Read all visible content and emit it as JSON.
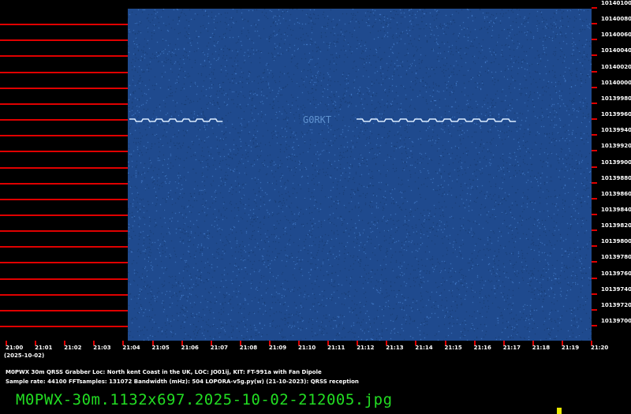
{
  "waterfall": {
    "background_color": "#1f4a8e",
    "noise_color": "#4a86d8",
    "signal_color": "#dcecff",
    "ident_text": "G0RKT",
    "ident_color": "#6fa4e0"
  },
  "reference_line_color": "#e00000",
  "frequency_axis": {
    "labels": [
      "10140100",
      "10140080",
      "10140060",
      "10140040",
      "10140020",
      "10140000",
      "10139980",
      "10139960",
      "10139940",
      "10139920",
      "10139900",
      "10139880",
      "10139860",
      "10139840",
      "10139820",
      "10139800",
      "10139780",
      "10139760",
      "10139740",
      "10139720",
      "10139700"
    ]
  },
  "time_axis": {
    "labels": [
      "21:00",
      "21:01",
      "21:02",
      "21:03",
      "21:04",
      "21:05",
      "21:06",
      "21:07",
      "21:08",
      "21:09",
      "21:10",
      "21:11",
      "21:12",
      "21:13",
      "21:14",
      "21:15",
      "21:16",
      "21:17",
      "21:18",
      "21:19",
      "21:20"
    ],
    "date": "(2025-10-02)"
  },
  "info": {
    "line1": "M0PWX 30m QRSS Grabber Loc: North kent Coast in the UK, LOC: JO01ij, KIT: FT-991a with Fan Dipole",
    "line2": "Sample rate: 44100      FFTsamples: 131072      Bandwidth (mHz): 504          LOPORA-v5g.py(w) (21-10-2023): QRSS reception"
  },
  "footer": {
    "filename": "M0PWX-30m.1132x697.2025-10-02-212005.jpg",
    "filename_color": "#22dd22"
  }
}
